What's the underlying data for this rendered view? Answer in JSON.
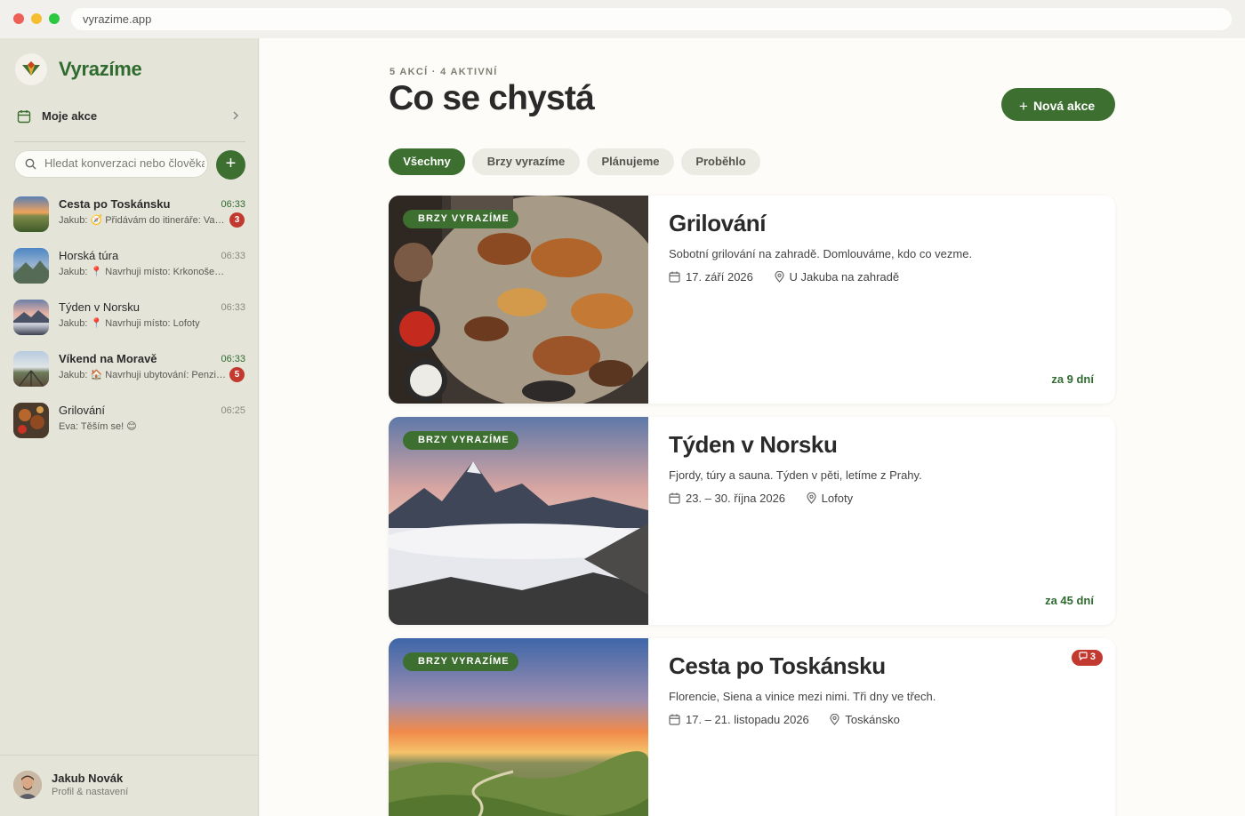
{
  "browser": {
    "url": "vyrazime.app"
  },
  "sidebar": {
    "brand": "Vyrazíme",
    "my_events_label": "Moje akce",
    "search_placeholder": "Hledat konverzaci nebo člověka",
    "add_label": "+",
    "conversations": [
      {
        "title": "Cesta po Toskánsku",
        "time": "06:33",
        "preview": "Jakub: 🧭 Přidávám do itineráře: Val d'Orcia",
        "unread": true,
        "badge": "3"
      },
      {
        "title": "Horská túra",
        "time": "06:33",
        "preview": "Jakub: 📍 Navrhuji místo: Krkonoše – chata",
        "unread": false,
        "badge": ""
      },
      {
        "title": "Týden v Norsku",
        "time": "06:33",
        "preview": "Jakub: 📍 Navrhuji místo: Lofoty",
        "unread": false,
        "badge": ""
      },
      {
        "title": "Víkend na Moravě",
        "time": "06:33",
        "preview": "Jakub: 🏠 Navrhuji ubytování: Penzion",
        "unread": true,
        "badge": "5"
      },
      {
        "title": "Grilování",
        "time": "06:25",
        "preview": "Eva: Těším se! 😊",
        "unread": false,
        "badge": ""
      }
    ],
    "profile": {
      "name": "Jakub Novák",
      "subtitle": "Profil & nastavení"
    }
  },
  "main": {
    "eyebrow": "5 AKCÍ · 4 AKTIVNÍ",
    "title": "Co se chystá",
    "new_button": "Nová akce",
    "filters": [
      "Všechny",
      "Brzy vyrazíme",
      "Plánujeme",
      "Proběhlo"
    ],
    "active_filter": "Všechny",
    "events": [
      {
        "tag": "BRZY VYRAZÍME",
        "title": "Grilování",
        "description": "Sobotní grilování na zahradě. Domlouváme, kdo co vezme.",
        "date": "17. září 2026",
        "place": "U Jakuba na zahradě",
        "due": "za 9 dní",
        "badge": ""
      },
      {
        "tag": "BRZY VYRAZÍME",
        "title": "Týden v Norsku",
        "description": "Fjordy, túry a sauna. Týden v pěti, letíme z Prahy.",
        "date": "23. – 30. října 2026",
        "place": "Lofoty",
        "due": "za 45 dní",
        "badge": ""
      },
      {
        "tag": "BRZY VYRAZÍME",
        "title": "Cesta po Toskánsku",
        "description": "Florencie, Siena a vinice mezi nimi. Tři dny ve třech.",
        "date": "17. – 21. listopadu 2026",
        "place": "Toskánsko",
        "due": "",
        "badge": "3"
      }
    ]
  },
  "colors": {
    "accent": "#3c6f30",
    "badge": "#c2392f",
    "sidebar_bg": "#e4e4d9",
    "main_bg": "#fdfcf8"
  }
}
